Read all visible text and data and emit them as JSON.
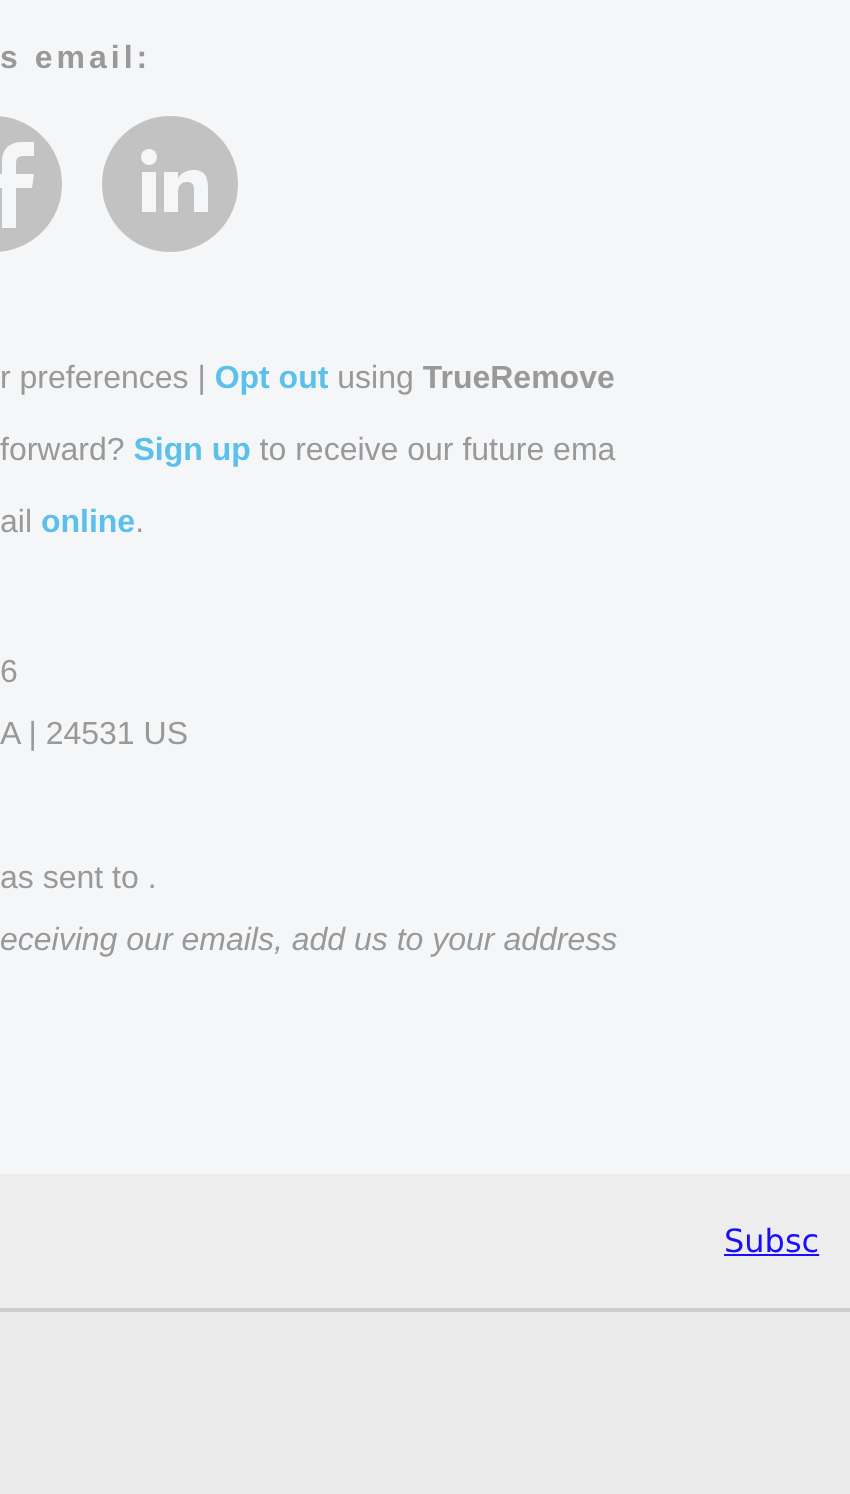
{
  "share_heading": "s email:",
  "social": [
    {
      "kind": "facebook"
    },
    {
      "kind": "linkedin"
    }
  ],
  "footer_lines": [
    {
      "parts": [
        {
          "kind": "text",
          "text": "r preferences | "
        },
        {
          "kind": "link",
          "text": "Opt out"
        },
        {
          "kind": "text",
          "text": " using "
        },
        {
          "kind": "bold",
          "text": "TrueRemove"
        }
      ]
    },
    {
      "parts": [
        {
          "kind": "text",
          "text": "forward? "
        },
        {
          "kind": "link",
          "text": "Sign up"
        },
        {
          "kind": "text",
          "text": " to receive our future ema"
        }
      ]
    },
    {
      "parts": [
        {
          "kind": "text",
          "text": "ail "
        },
        {
          "kind": "link",
          "text": "online"
        },
        {
          "kind": "text",
          "text": "."
        }
      ]
    }
  ],
  "address": [
    "6",
    "A | 24531 US"
  ],
  "sent_to": "as sent to .",
  "safe_sender_note": "eceiving our emails, add us to your address",
  "subscribe_link": "Subsc"
}
